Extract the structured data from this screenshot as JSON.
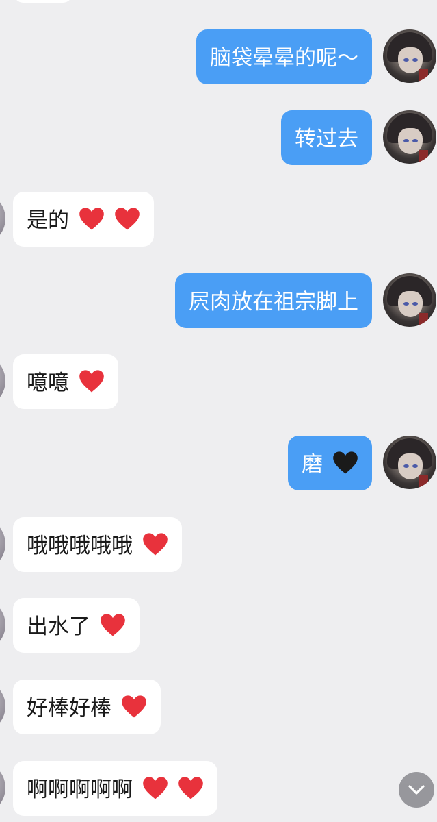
{
  "messages": [
    {
      "text": "脑袋晕晕的呢～",
      "direction": "out",
      "hearts": []
    },
    {
      "text": "转过去",
      "direction": "out",
      "hearts": []
    },
    {
      "text": "是的",
      "direction": "in",
      "hearts": [
        "red-heart",
        "red-heart"
      ]
    },
    {
      "text": "屄肉放在祖宗脚上",
      "direction": "out",
      "hearts": []
    },
    {
      "text": "噫噫",
      "direction": "in",
      "hearts": [
        "red-heart"
      ]
    },
    {
      "text": "磨",
      "direction": "out",
      "hearts": [
        "black-heart"
      ]
    },
    {
      "text": "哦哦哦哦哦",
      "direction": "in",
      "hearts": [
        "red-heart"
      ]
    },
    {
      "text": "出水了",
      "direction": "in",
      "hearts": [
        "red-heart"
      ]
    },
    {
      "text": "好棒好棒",
      "direction": "in",
      "hearts": [
        "red-heart"
      ]
    },
    {
      "text": "啊啊啊啊啊",
      "direction": "in",
      "hearts": [
        "red-heart",
        "red-heart"
      ]
    }
  ],
  "colors": {
    "background": "#eeeef0",
    "outgoing_bubble": "#4a9ef5",
    "incoming_bubble": "#ffffff",
    "red_heart": "#e8323c",
    "black_heart": "#1a1a1a",
    "scroll_button": "#8e8e93"
  },
  "scroll_button_icon": "chevron-down-icon"
}
